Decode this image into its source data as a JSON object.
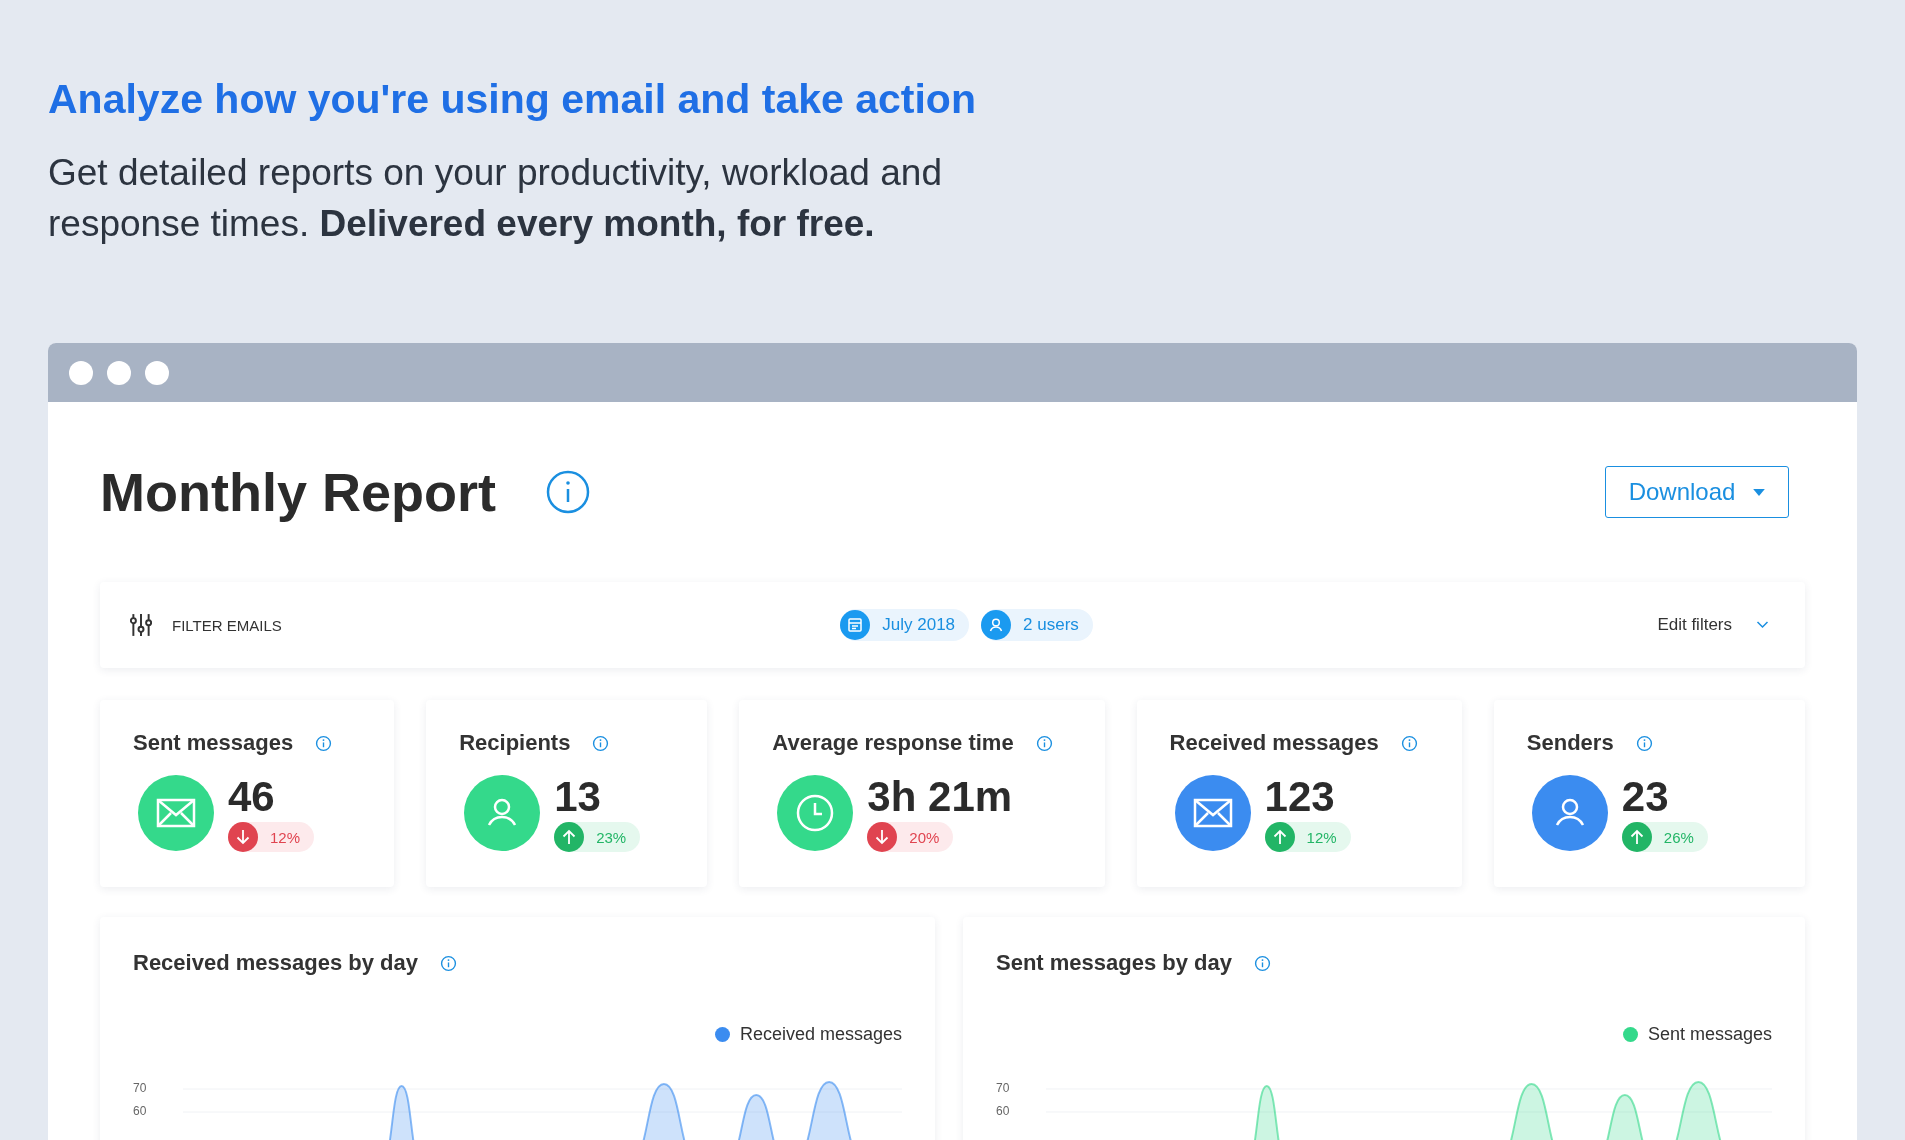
{
  "headline": "Analyze how you're using email and take action",
  "intro": "Get detailed reports on your productivity, workload and response times. **Delivered every month, for free.**",
  "report": {
    "title": "Monthly Report",
    "download_button": "Download",
    "filter_bar": {
      "label": "FILTER EMAILS",
      "chips": [
        {
          "kind": "calendar",
          "label": "July 2018"
        },
        {
          "kind": "user",
          "label": "2 users"
        }
      ],
      "edit": "Edit filters"
    },
    "stats": [
      {
        "title": "Sent messages",
        "value": "46",
        "kind": "mail",
        "color": "#34d98b",
        "change": {
          "kind": "down",
          "label": "12%"
        }
      },
      {
        "title": "Recipients",
        "value": "13",
        "kind": "user",
        "color": "#34d98b",
        "change": {
          "kind": "up",
          "label": "23%"
        }
      },
      {
        "title": "Average response time",
        "value": "3h 21m",
        "kind": "clock",
        "color": "#34d98b",
        "change": {
          "kind": "down",
          "label": "20%"
        }
      },
      {
        "title": "Received messages",
        "value": "123",
        "kind": "mail",
        "color": "#3b8cf0",
        "change": {
          "kind": "up",
          "label": "12%"
        }
      },
      {
        "title": "Senders",
        "value": "23",
        "kind": "user",
        "color": "#3b8cf0",
        "change": {
          "kind": "up",
          "label": "26%"
        }
      }
    ],
    "charts": [
      {
        "title": "Received messages by day",
        "legend": "Received messages",
        "color": "#3b8cf0",
        "ticks": [
          "70",
          "60"
        ]
      },
      {
        "title": "Sent messages by day",
        "legend": "Sent messages",
        "color": "#34d98b",
        "ticks": [
          "70",
          "60"
        ]
      }
    ]
  }
}
